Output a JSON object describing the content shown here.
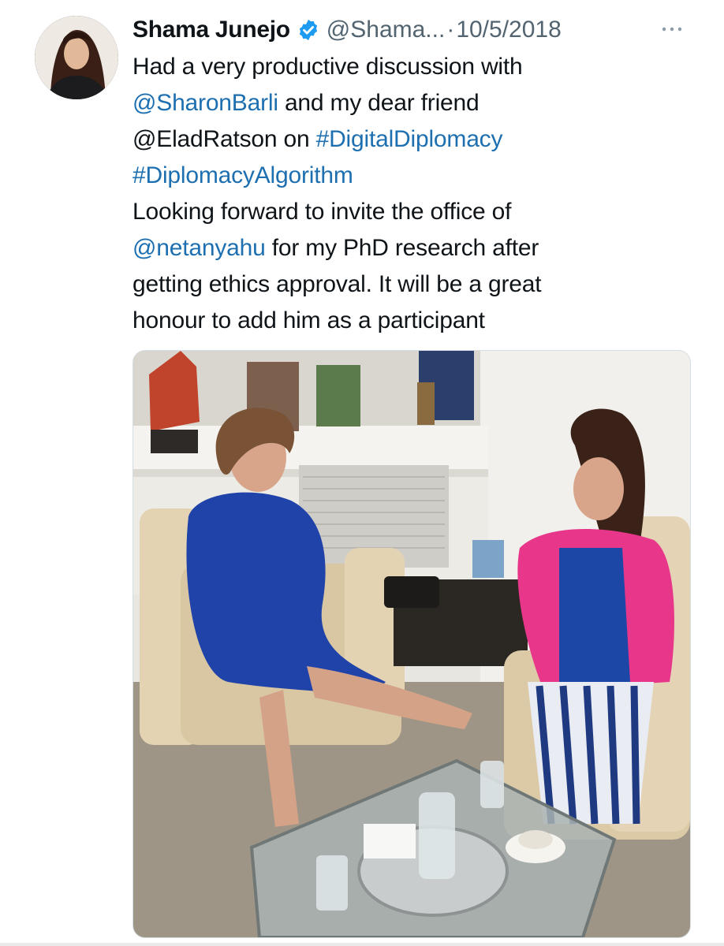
{
  "tweet": {
    "author": {
      "display_name": "Shama Junejo",
      "handle": "@Shama...",
      "verified_icon": "verified-badge-icon"
    },
    "separator": "·",
    "date": "10/5/2018",
    "more_icon": "more-options-icon",
    "text_lines": [
      [
        {
          "text": "Had a very productive discussion with",
          "link": false
        }
      ],
      [
        {
          "text": "@SharonBarli",
          "link": true
        },
        {
          "text": " and my dear friend",
          "link": false
        }
      ],
      [
        {
          "text": "@EladRatson on ",
          "link": false
        },
        {
          "text": "#DigitalDiplomacy",
          "link": true
        }
      ],
      [
        {
          "text": "#DiplomacyAlgorithm",
          "link": true
        }
      ],
      [
        {
          "text": "Looking forward to invite the office of",
          "link": false
        }
      ],
      [
        {
          "text": "@netanyahu",
          "link": true
        },
        {
          "text": " for my PhD research after",
          "link": false
        }
      ],
      [
        {
          "text": "getting ethics approval. It will be a great",
          "link": false
        }
      ],
      [
        {
          "text": "honour to add him as a participant",
          "link": false
        }
      ]
    ],
    "colors": {
      "link": "#1d6fb0",
      "verified": "#1d9bf0",
      "muted": "#536471"
    }
  }
}
